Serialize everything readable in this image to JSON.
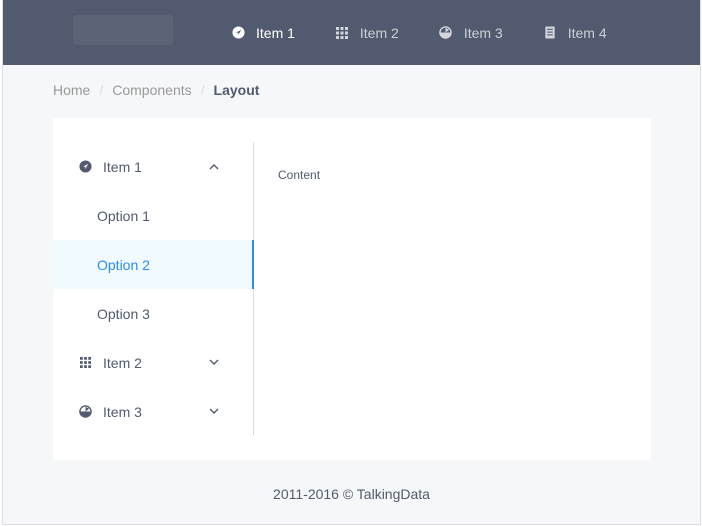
{
  "header": {
    "nav": [
      {
        "label": "Item 1",
        "icon": "navigate-icon",
        "active": true
      },
      {
        "label": "Item 2",
        "icon": "grid-icon",
        "active": false
      },
      {
        "label": "Item 3",
        "icon": "pie-icon",
        "active": false
      },
      {
        "label": "Item 4",
        "icon": "document-icon",
        "active": false
      }
    ]
  },
  "breadcrumb": {
    "items": [
      "Home",
      "Components",
      "Layout"
    ],
    "separator": "/"
  },
  "sidebar": {
    "item1": {
      "label": "Item 1",
      "icon": "navigate-icon",
      "expanded": true
    },
    "options": [
      "Option 1",
      "Option 2",
      "Option 3"
    ],
    "active_option": "Option 2",
    "item2": {
      "label": "Item 2",
      "icon": "grid-icon",
      "expanded": false
    },
    "item3": {
      "label": "Item 3",
      "icon": "pie-icon",
      "expanded": false
    }
  },
  "main": {
    "content": "Content"
  },
  "footer": {
    "text": "2011-2016 © TalkingData"
  },
  "colors": {
    "header_bg": "#515a6e",
    "accent": "#2d8cf0",
    "active_bg": "#f0faff",
    "page_bg": "#f5f7f9"
  }
}
